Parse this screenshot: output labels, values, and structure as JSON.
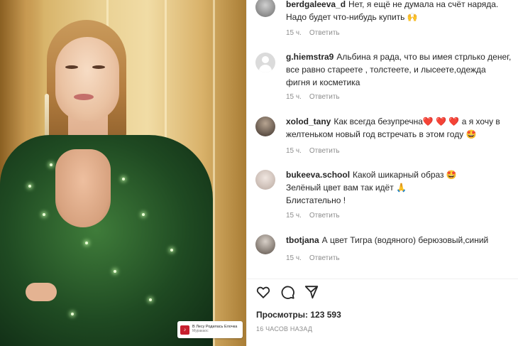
{
  "media": {
    "music": {
      "title": "В Лесу Родилась Елочка",
      "artist": "Муракаос",
      "icon": "music-app-logo"
    }
  },
  "comments": [
    {
      "username": "berdgaleeva_d",
      "text": "Нет, я ещё не думала на счёт наряда. Надо будет что-нибудь купить 🙌",
      "time": "15 ч.",
      "reply_label": "Ответить"
    },
    {
      "username": "g.hiemstra9",
      "text": "Альбина я рада, что вы имея стрлько денег, все равно стареете , толстеете, и лысеете,одежда фигня и косметика",
      "time": "15 ч.",
      "reply_label": "Ответить"
    },
    {
      "username": "xolod_tany",
      "text": "Как всегда безупречна❤️ ❤️ ❤️ а я хочу в желтеньком новый год встречать в этом году 🤩",
      "time": "15 ч.",
      "reply_label": "Ответить"
    },
    {
      "username": "bukeeva.school",
      "text": "Какой шикарный образ 🤩",
      "text_line2": "Зелёный цвет вам так идёт 🙏",
      "text_line3": "Блистательно !",
      "time": "15 ч.",
      "reply_label": "Ответить"
    },
    {
      "username": "tbotjana",
      "text": "А цвет Тигра (водяного) берюзовый,синий",
      "time": "15 ч.",
      "reply_label": "Ответить"
    }
  ],
  "actions": {
    "icons": [
      "heart-icon",
      "comment-icon",
      "share-icon"
    ]
  },
  "stats": {
    "views_label": "Просмотры:",
    "views_value": "123 593",
    "time_ago": "16 ЧАСОВ НАЗАД"
  },
  "colors": {
    "text": "#262626",
    "muted": "#8e8e8e",
    "music_brand": "#c7202e"
  }
}
